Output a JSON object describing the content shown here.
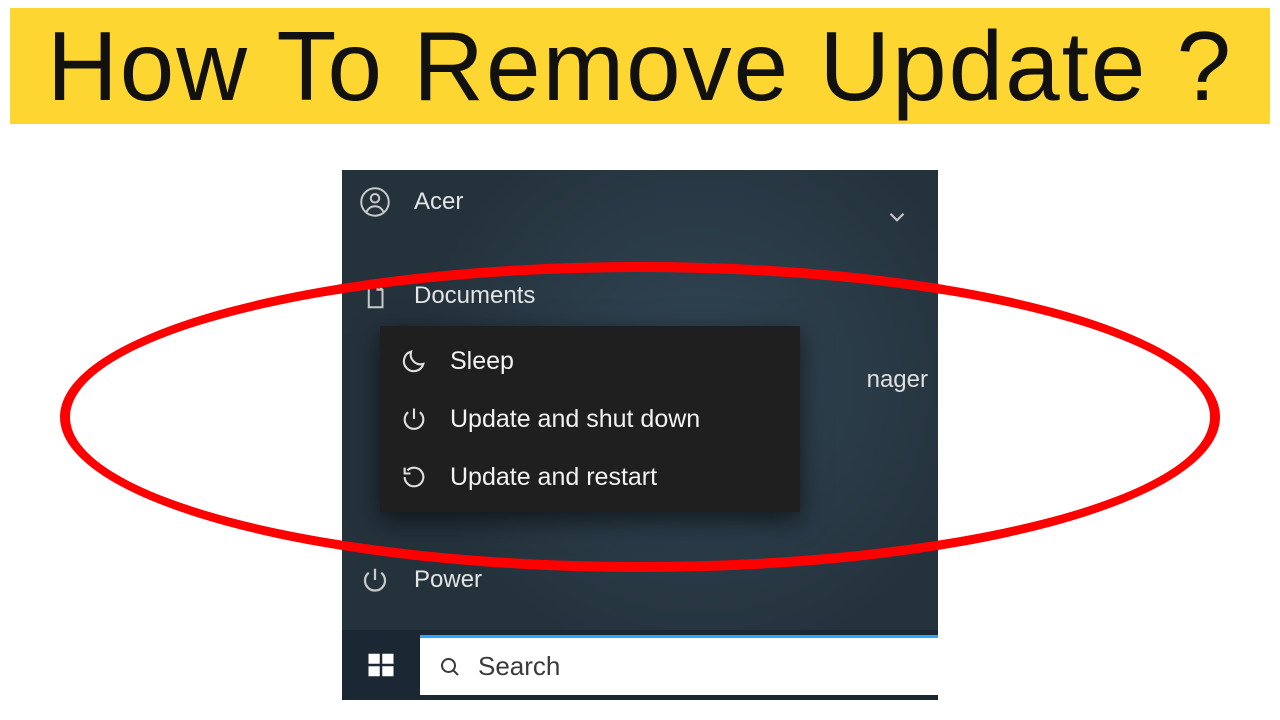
{
  "banner": {
    "title": "How To Remove Update ?"
  },
  "user": {
    "name": "Acer"
  },
  "rail": {
    "documents": "Documents",
    "power": "Power"
  },
  "flyout": {
    "sleep": "Sleep",
    "update_shutdown": "Update and shut down",
    "update_restart": "Update and restart"
  },
  "background": {
    "partial_word": "nager"
  },
  "search": {
    "placeholder": "Search"
  },
  "colors": {
    "banner_bg": "#fed631",
    "annotation_red": "#ff0000",
    "taskbar_bg": "#1b2733",
    "search_accent": "#2aa7ff"
  }
}
